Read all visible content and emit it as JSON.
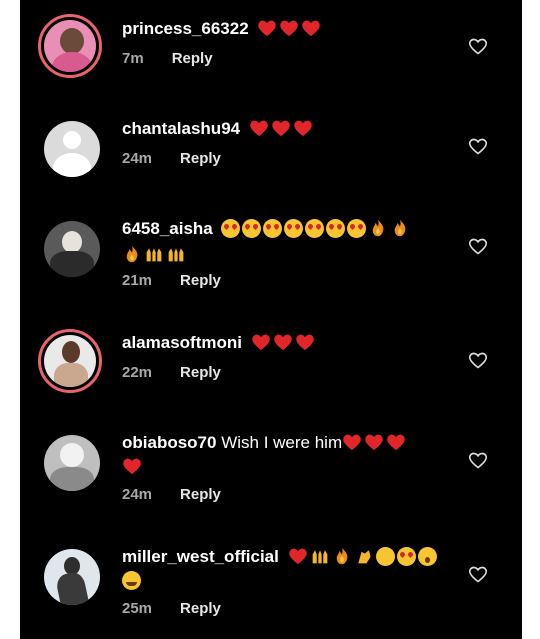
{
  "comments": [
    {
      "username": "princess_66322",
      "text": "",
      "time": "7m",
      "reply_label": "Reply",
      "emojis": [
        "red-heart",
        "red-heart",
        "red-heart"
      ],
      "avatar": "photo-ring"
    },
    {
      "username": "chantalashu94",
      "text": "",
      "time": "24m",
      "reply_label": "Reply",
      "emojis": [
        "red-heart",
        "red-heart",
        "red-heart"
      ],
      "avatar": "default"
    },
    {
      "username": "6458_aisha",
      "text": "",
      "time": "21m",
      "reply_label": "Reply",
      "emojis": [
        "heart-eyes",
        "heart-eyes",
        "heart-eyes",
        "heart-eyes",
        "heart-eyes",
        "heart-eyes",
        "heart-eyes",
        "fire",
        "fire",
        "fire",
        "raising-hands",
        "raising-hands"
      ],
      "avatar": "photo"
    },
    {
      "username": "alamasoftmoni",
      "text": "",
      "time": "22m",
      "reply_label": "Reply",
      "emojis": [
        "red-heart",
        "red-heart",
        "red-heart"
      ],
      "avatar": "photo-ring"
    },
    {
      "username": "obiaboso70",
      "text": "Wish I were him",
      "time": "24m",
      "reply_label": "Reply",
      "emojis": [
        "red-heart",
        "red-heart",
        "red-heart",
        "red-heart"
      ],
      "avatar": "photo"
    },
    {
      "username": "miller_west_official",
      "text": "",
      "time": "25m",
      "reply_label": "Reply",
      "emojis": [
        "red-heart",
        "raising-hands",
        "fire",
        "clapping-hands",
        "crying-face",
        "heart-eyes",
        "astonished-face",
        "joy-face"
      ],
      "avatar": "photo"
    }
  ],
  "colors": {
    "background": "#000000",
    "username": "#ffffff",
    "meta": "#a8a8a8",
    "story_ring": "#e8636b",
    "heart": "#e0262b"
  }
}
